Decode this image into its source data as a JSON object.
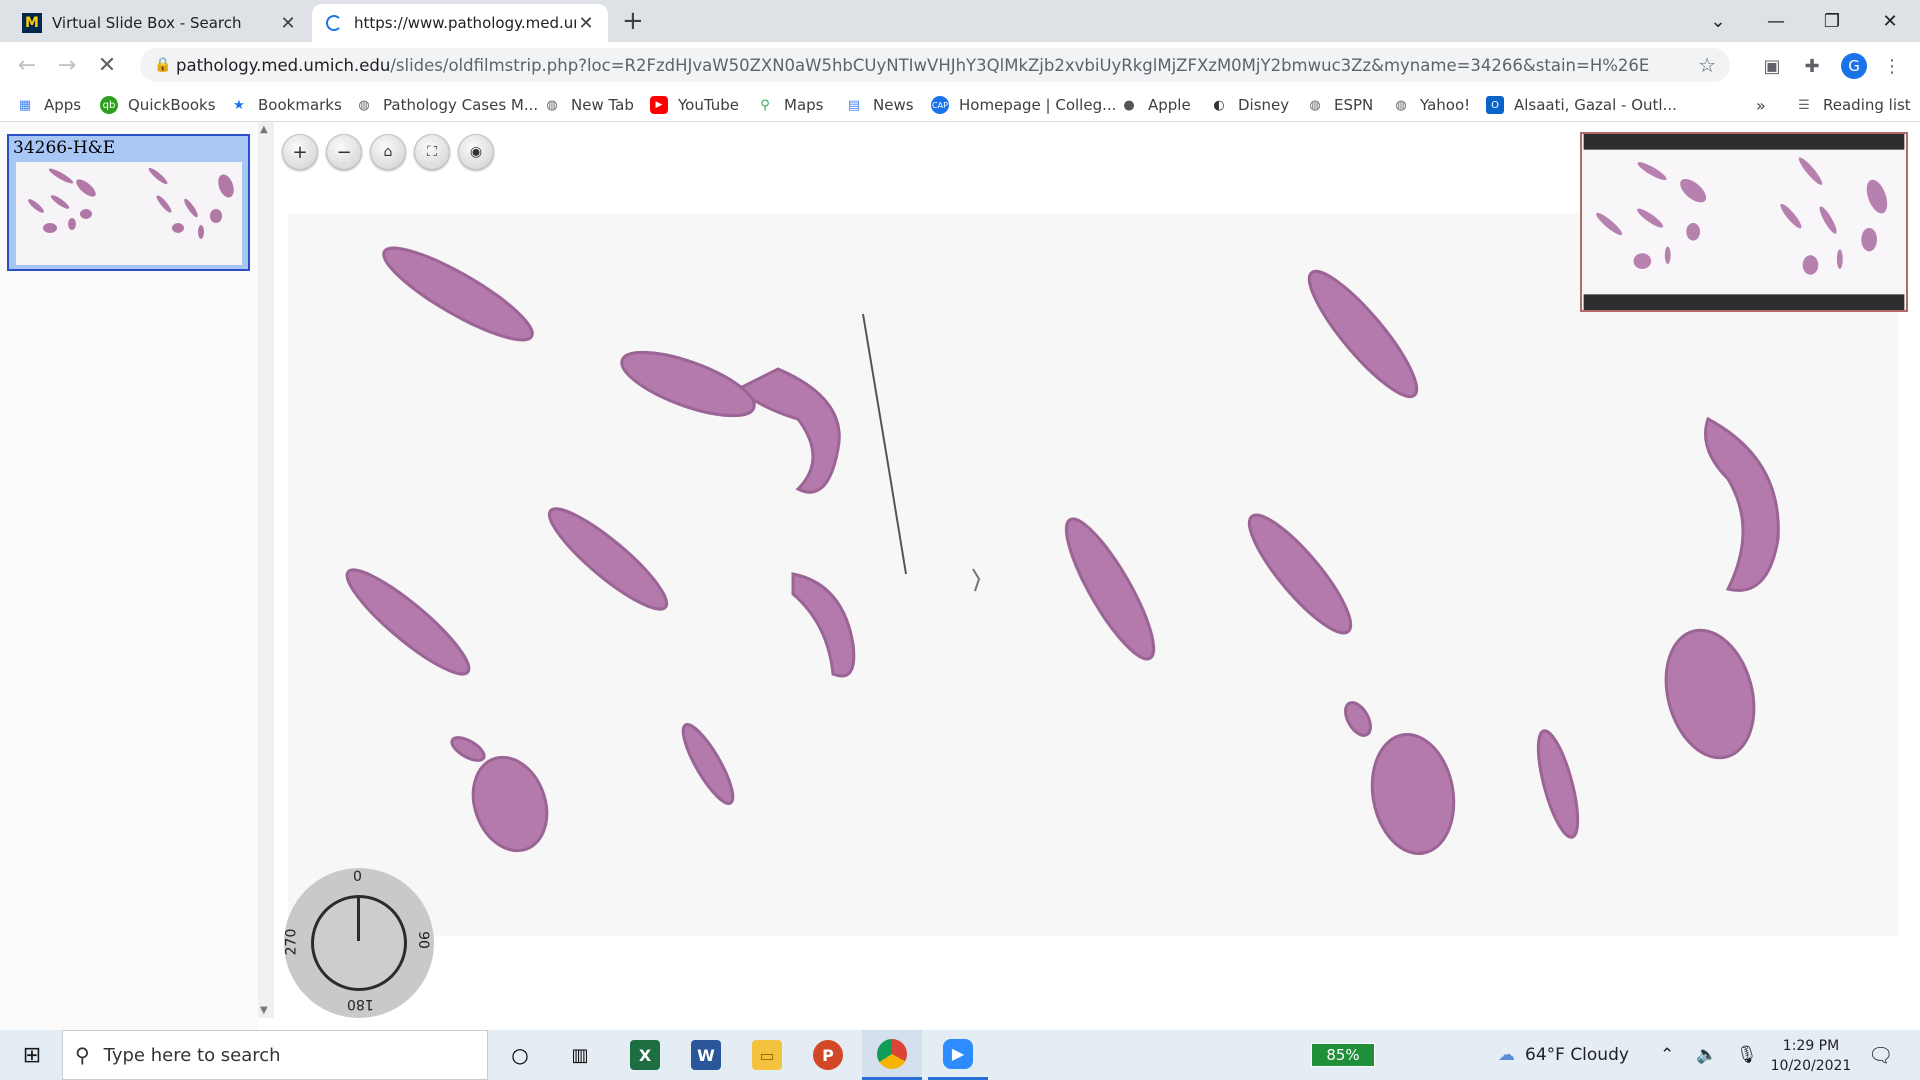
{
  "browser": {
    "tabs": [
      {
        "title": "Virtual Slide Box - Search",
        "active": false
      },
      {
        "title": "https://www.pathology.med.umic",
        "active": true
      }
    ],
    "url_host": "pathology.med.umich.edu",
    "url_path": "/slides/oldfilmstrip.php?loc=R2FzdHJvaW50ZXN0aW5hbCUyNTIwVHJhY3QlMkZjb2xvbiUyRkglMjZFXzM0MjY2bmwuc3Zz&myname=34266&stain=H%26E",
    "profile_initial": "G",
    "bookmarks": [
      {
        "label": "Apps",
        "icon": "apps-grid-icon"
      },
      {
        "label": "QuickBooks",
        "icon": "quickbooks-icon"
      },
      {
        "label": "Bookmarks",
        "icon": "star-icon"
      },
      {
        "label": "Pathology Cases M...",
        "icon": "globe-icon"
      },
      {
        "label": "New Tab",
        "icon": "globe-icon"
      },
      {
        "label": "YouTube",
        "icon": "youtube-icon"
      },
      {
        "label": "Maps",
        "icon": "maps-icon"
      },
      {
        "label": "News",
        "icon": "news-icon"
      },
      {
        "label": "Homepage | Colleg...",
        "icon": "cap-icon"
      },
      {
        "label": "Apple",
        "icon": "apple-icon"
      },
      {
        "label": "Disney",
        "icon": "disney-icon"
      },
      {
        "label": "ESPN",
        "icon": "globe-icon"
      },
      {
        "label": "Yahoo!",
        "icon": "globe-icon"
      },
      {
        "label": "Alsaati, Gazal - Outl...",
        "icon": "outlook-icon"
      }
    ],
    "overflow": "»",
    "reading_list": "Reading list"
  },
  "viewer": {
    "slide_label": "34266-H&E",
    "dial": {
      "top": "0",
      "right": "90",
      "bottom": "180",
      "left": "270"
    }
  },
  "taskbar": {
    "search_placeholder": "Type here to search",
    "battery": "85%",
    "weather": "64°F  Cloudy",
    "time": "1:29 PM",
    "date": "10/20/2021"
  }
}
